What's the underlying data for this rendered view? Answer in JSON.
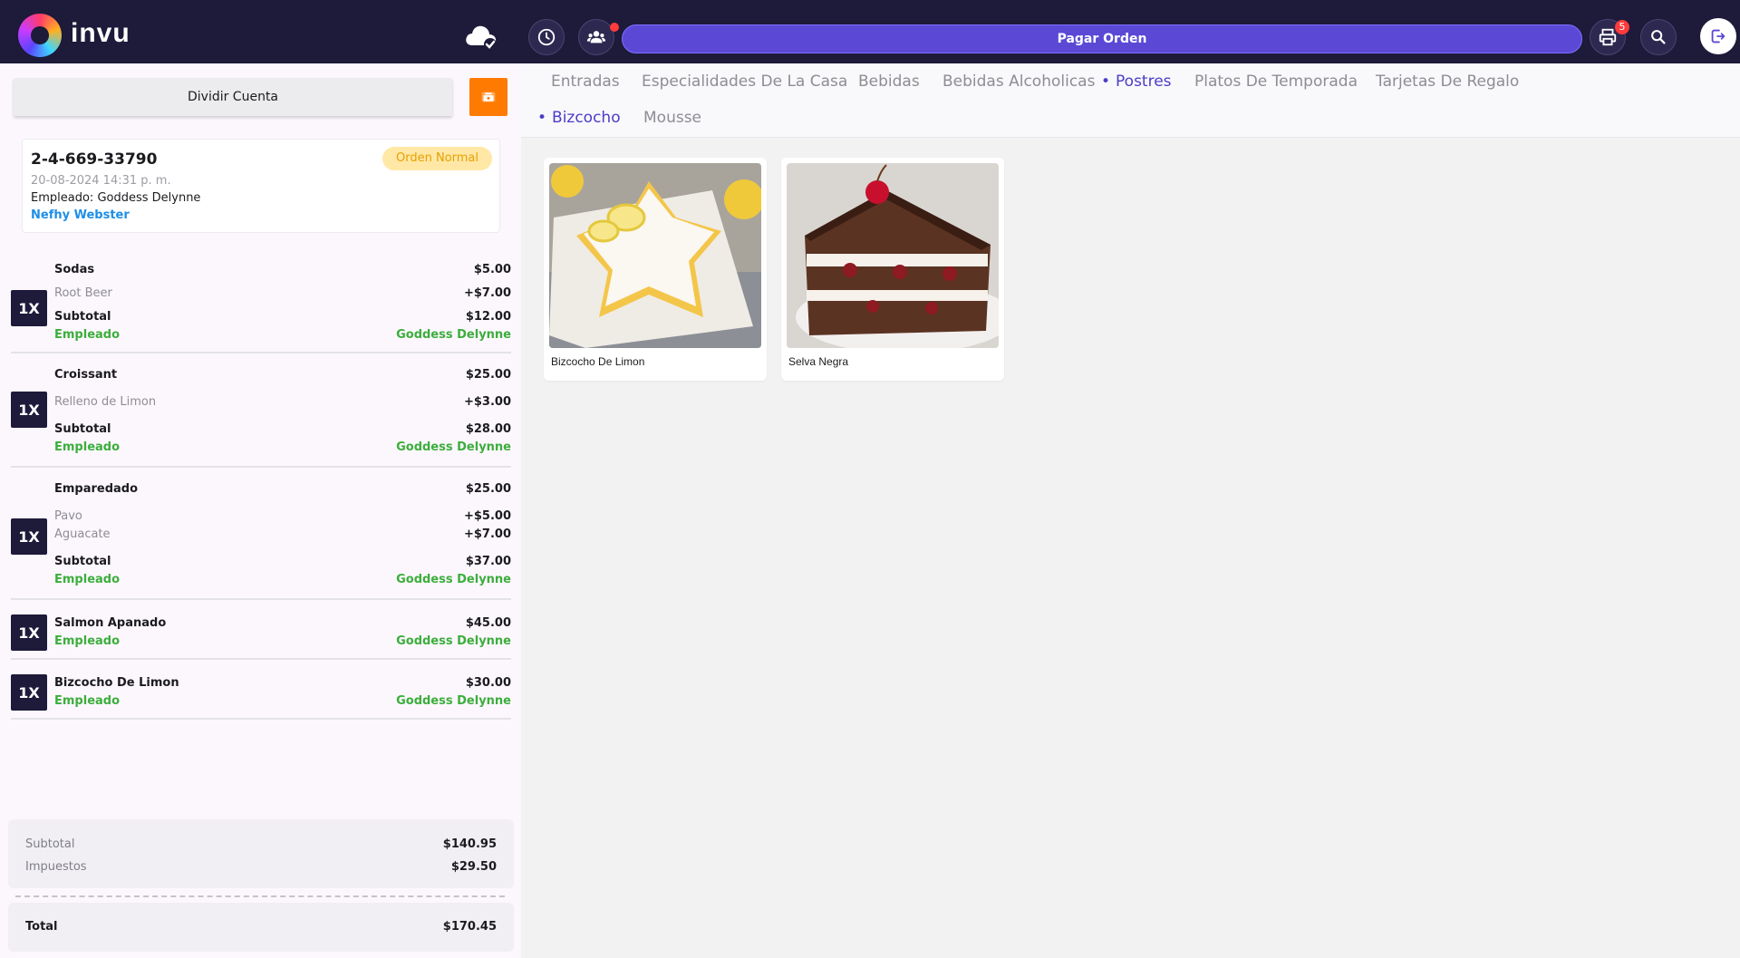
{
  "app": {
    "brand": "invu",
    "pay_order_label": "Pagar Orden",
    "notification_count": "5"
  },
  "left": {
    "split_label": "Dividir Cuenta",
    "order": {
      "number": "2-4-669-33790",
      "type": "Orden Normal",
      "date": "20-08-2024 14:31 p. m.",
      "employee_prefix": "Empleado:",
      "employee": "Goddess Delynne",
      "customer": "Nefhy Webster"
    },
    "items": [
      {
        "qty": "1X",
        "name": "Sodas",
        "price": "$5.00",
        "mods": [
          {
            "name": "Root Beer",
            "price": "+$7.00"
          }
        ],
        "subtotal_label": "Subtotal",
        "subtotal": "$12.00",
        "employee_label": "Empleado",
        "employee": "Goddess Delynne"
      },
      {
        "qty": "1X",
        "name": "Croissant",
        "price": "$25.00",
        "mods": [
          {
            "name": "Relleno de Limon",
            "price": "+$3.00"
          }
        ],
        "subtotal_label": "Subtotal",
        "subtotal": "$28.00",
        "employee_label": "Empleado",
        "employee": "Goddess Delynne"
      },
      {
        "qty": "1X",
        "name": "Emparedado",
        "price": "$25.00",
        "mods": [
          {
            "name": "Pavo",
            "price": "+$5.00"
          },
          {
            "name": "Aguacate",
            "price": "+$7.00"
          }
        ],
        "subtotal_label": "Subtotal",
        "subtotal": "$37.00",
        "employee_label": "Empleado",
        "employee": "Goddess Delynne"
      },
      {
        "qty": "1X",
        "name": "Salmon Apanado",
        "price": "$45.00",
        "employee_label": "Empleado",
        "employee": "Goddess Delynne"
      },
      {
        "qty": "1X",
        "name": "Bizcocho De Limon",
        "price": "$30.00",
        "employee_label": "Empleado",
        "employee": "Goddess Delynne"
      }
    ],
    "totals": {
      "subtotal_label": "Subtotal",
      "subtotal": "$140.95",
      "tax_label": "Impuestos",
      "tax": "$29.50",
      "total_label": "Total",
      "total": "$170.45"
    }
  },
  "categories": {
    "tabs": [
      "Entradas",
      "Especialidades De La Casa",
      "Bebidas",
      "Bebidas Alcoholicas",
      "Postres",
      "Platos De Temporada",
      "Tarjetas De Regalo"
    ],
    "active_tab": "Postres",
    "subtabs": [
      "Bizcocho",
      "Mousse"
    ],
    "active_subtab": "Bizcocho"
  },
  "products": [
    {
      "name": "Bizcocho De Limon",
      "icon": "lemon-cake-image"
    },
    {
      "name": "Selva Negra",
      "icon": "black-forest-cake-image"
    }
  ],
  "colors": {
    "topbar": "#1d1a3a",
    "accent": "#5b49d6",
    "orange": "#ff7a00",
    "employee_green": "#3cae3c",
    "customer_blue": "#1e8ee6"
  }
}
